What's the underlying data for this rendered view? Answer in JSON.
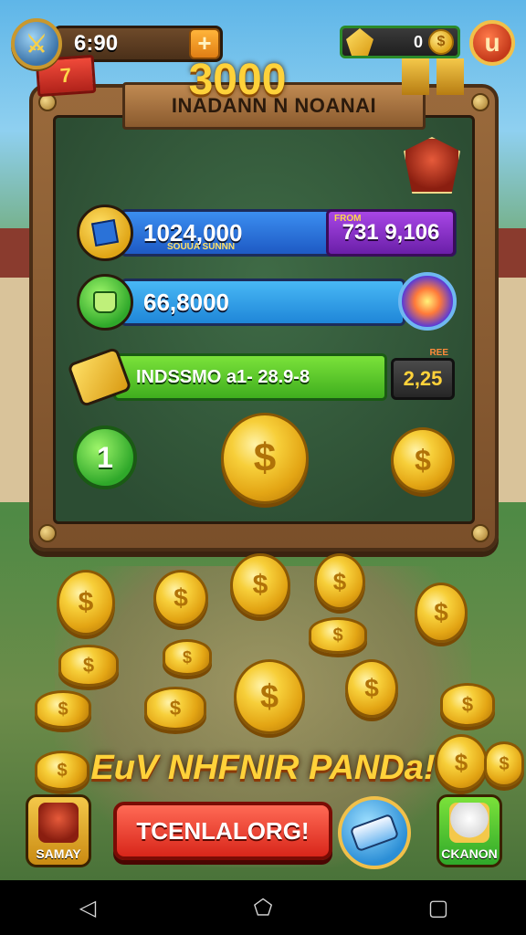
{
  "hud": {
    "currency_value": "6:90",
    "plus_label": "+",
    "right_value": "0",
    "coin_symbol": "$",
    "close_label": "u"
  },
  "board": {
    "title": "INADANN N NOANAI",
    "level_badge": "7",
    "big_number": "3000"
  },
  "rows": [
    {
      "value": "1024,000",
      "sub": "SOUUA SUNNN",
      "tag_label": "FROM",
      "tag_value": "731 9,106"
    },
    {
      "value": "66,8000"
    },
    {
      "value": "INDSSMO a1- 28.9-8",
      "tag_label": "REE",
      "tag_value": "2,25"
    }
  ],
  "green_badge": "1",
  "coin_symbol": "$",
  "promo": "EuV NHFNIR PANDa!",
  "bottom": {
    "left_label": "SAMAY",
    "main_label": "TCENLALORG!",
    "right_label": "CKANON"
  },
  "colors": {
    "accent_gold": "#ffd23a",
    "accent_red": "#d8261a",
    "row1_blue": "#2a72d8",
    "row2_blue": "#2fa0e8",
    "row3_green": "#5ecf2a"
  },
  "icons": {
    "hud_emblem": "sword-icon",
    "hud_gem": "gem-icon",
    "crest": "eagle-crest-icon",
    "row1": "blue-gem-icon",
    "row2": "green-bag-icon",
    "row3": "ticket-icon",
    "orb": "lightning-orb-icon"
  }
}
